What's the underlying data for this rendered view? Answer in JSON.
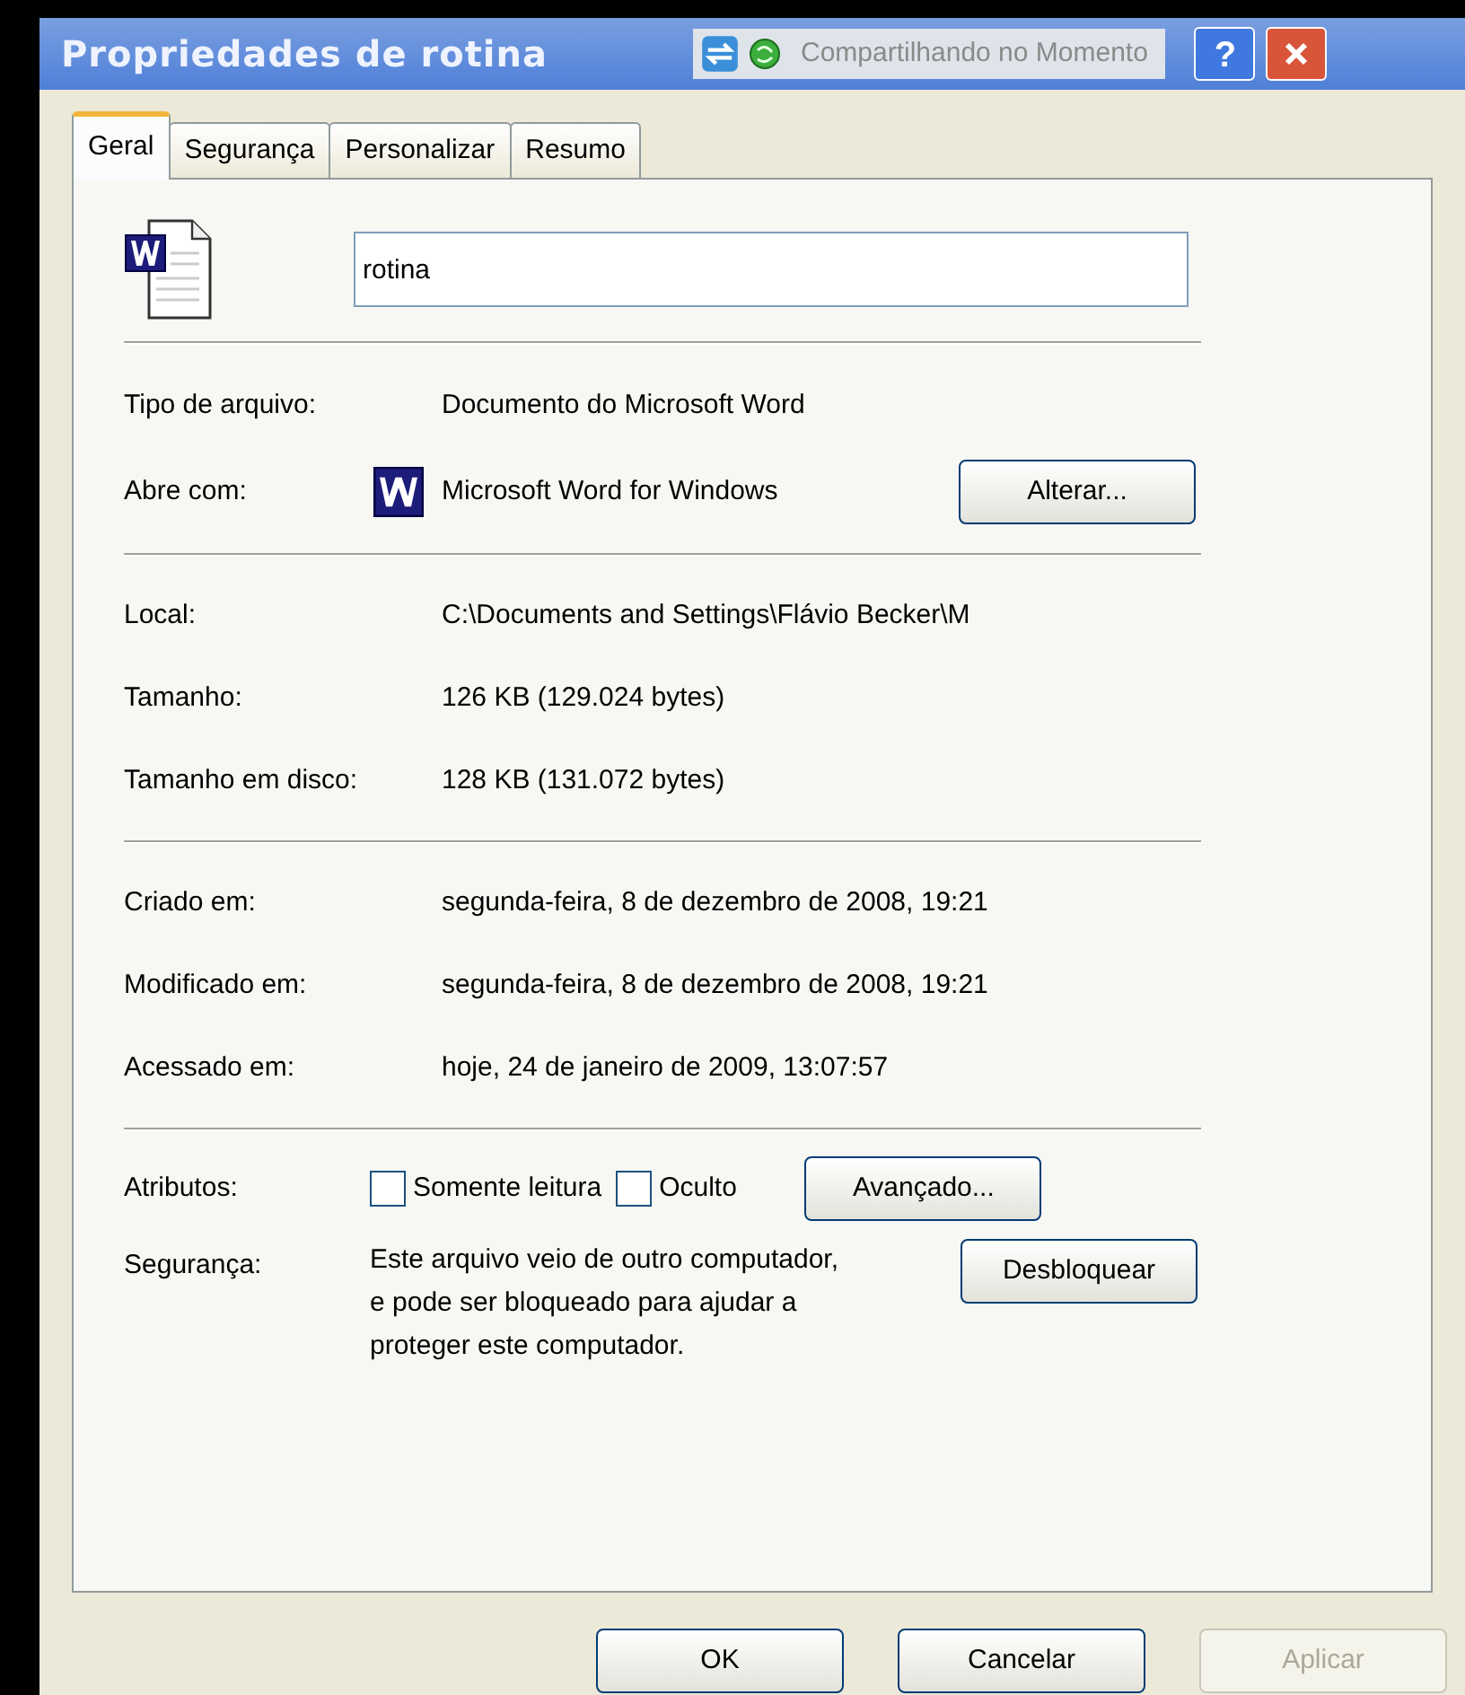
{
  "window": {
    "title": "Propriedades de rotina",
    "sharing_label": "Compartilhando no Momento",
    "help": "?"
  },
  "tabs": [
    {
      "label": "Geral",
      "selected": true
    },
    {
      "label": "Segurança",
      "selected": false
    },
    {
      "label": "Personalizar",
      "selected": false
    },
    {
      "label": "Resumo",
      "selected": false
    }
  ],
  "file_name": {
    "value": "rotina"
  },
  "type_section": [
    {
      "label": "Tipo de arquivo:",
      "value": "Documento do Microsoft Word",
      "kind": "text"
    },
    {
      "label": "Abre com:",
      "value": "Microsoft Word for Windows",
      "kind": "app",
      "button": "Alterar..."
    }
  ],
  "location_section": [
    {
      "label": "Local:",
      "value": "C:\\Documents and Settings\\Flávio Becker\\M"
    },
    {
      "label": "Tamanho:",
      "value": "126 KB (129.024 bytes)"
    },
    {
      "label": "Tamanho em disco:",
      "value": "128 KB (131.072 bytes)"
    }
  ],
  "dates_section": [
    {
      "label": "Criado em:",
      "value": "segunda-feira, 8 de dezembro de 2008, 19:21"
    },
    {
      "label": "Modificado em:",
      "value": "segunda-feira, 8 de dezembro de 2008, 19:21"
    },
    {
      "label": "Acessado em:",
      "value": "hoje, 24 de janeiro de 2009, 13:07:57"
    }
  ],
  "attributes": {
    "label": "Atributos:",
    "checkboxes": [
      {
        "label": "Somente leitura",
        "checked": false
      },
      {
        "label": "Oculto",
        "checked": false
      }
    ],
    "button": "Avançado..."
  },
  "security": {
    "label": "Segurança:",
    "text": "Este arquivo veio de outro computador, e pode ser bloqueado para ajudar a proteger este computador.",
    "button": "Desbloquear"
  },
  "buttons": [
    {
      "label": "OK",
      "disabled": false
    },
    {
      "label": "Cancelar",
      "disabled": false
    },
    {
      "label": "Aplicar",
      "disabled": true
    }
  ]
}
